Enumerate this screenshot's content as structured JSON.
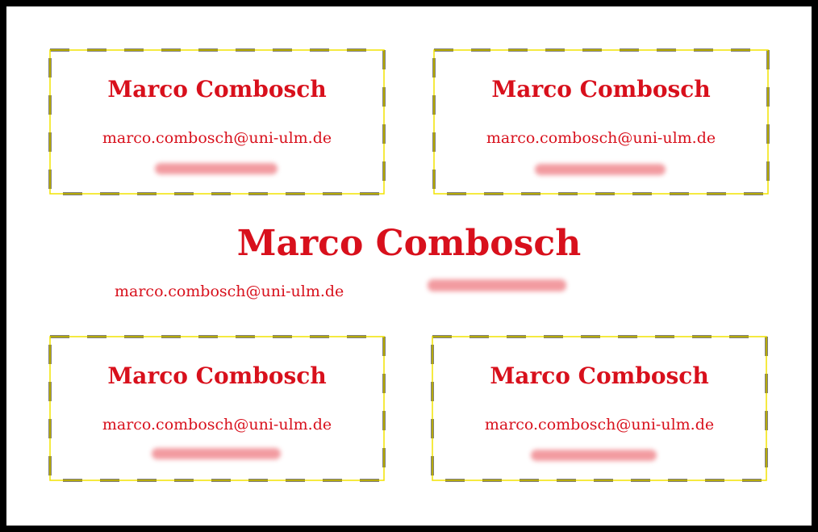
{
  "person": {
    "name": "Marco Combosch",
    "email": "marco.combosch@uni-ulm.de"
  },
  "colors": {
    "text": "#d8101c",
    "cut_line": "#000000",
    "card_outline": "#f2e300",
    "sheet_border": "#000000",
    "redaction": "#f08a90"
  },
  "cards": [
    {
      "name": "Marco Combosch",
      "email": "marco.combosch@uni-ulm.de"
    },
    {
      "name": "Marco Combosch",
      "email": "marco.combosch@uni-ulm.de"
    },
    {
      "name": "Marco Combosch",
      "email": "marco.combosch@uni-ulm.de"
    },
    {
      "name": "Marco Combosch",
      "email": "marco.combosch@uni-ulm.de"
    }
  ]
}
